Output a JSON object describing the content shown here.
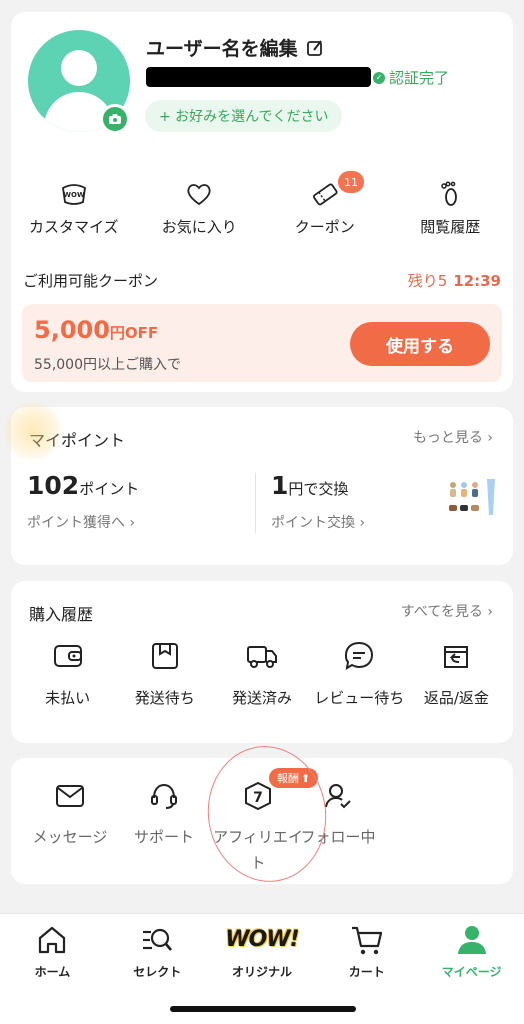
{
  "profile": {
    "username": "ユーザー名を編集",
    "verified_label": "認証完了",
    "preference_pill": "+ お好みを選んでください"
  },
  "quick_actions": [
    {
      "icon": "wow-icon",
      "label": "カスタマイズ"
    },
    {
      "icon": "heart-icon",
      "label": "お気に入り"
    },
    {
      "icon": "coupon-icon",
      "label": "クーポン",
      "badge": "11"
    },
    {
      "icon": "footprint-icon",
      "label": "閲覧履歴"
    }
  ],
  "coupon": {
    "heading": "ご利用可能クーポン",
    "remaining_label": "残り5",
    "timer": "12:39",
    "amount": "5,000",
    "amount_unit": "円OFF",
    "minimum": "55,000円以上ご購入で",
    "use_button": "使用する"
  },
  "points": {
    "title": "マイポイント",
    "more": "もっと見る",
    "balance_value": "102",
    "balance_unit": "ポイント",
    "earn_link": "ポイント獲得へ",
    "exchange_value": "1",
    "exchange_unit": "円で交換",
    "exchange_link": "ポイント交換"
  },
  "purchase": {
    "title": "購入履歴",
    "more": "すべてを見る",
    "items": [
      {
        "icon": "wallet-icon",
        "label": "未払い"
      },
      {
        "icon": "box-icon",
        "label": "発送待ち"
      },
      {
        "icon": "truck-icon",
        "label": "発送済み"
      },
      {
        "icon": "review-icon",
        "label": "レビュー待ち"
      },
      {
        "icon": "return-icon",
        "label": "返品/返金"
      }
    ]
  },
  "misc": [
    {
      "icon": "mail-icon",
      "label": "メッセージ"
    },
    {
      "icon": "headset-icon",
      "label": "サポート"
    },
    {
      "icon": "affiliate-icon",
      "label": "アフィリエイト",
      "badge": "報酬"
    },
    {
      "icon": "follow-icon",
      "label": "フォロー中"
    }
  ],
  "nav": [
    {
      "icon": "home-icon",
      "label": "ホーム"
    },
    {
      "icon": "select-icon",
      "label": "セレクト"
    },
    {
      "icon": "wow-original-logo",
      "label": "オリジナル"
    },
    {
      "icon": "cart-icon",
      "label": "カート"
    },
    {
      "icon": "mypage-icon",
      "label": "マイページ",
      "active": true
    }
  ],
  "colors": {
    "accent_green": "#37b26a",
    "coupon_orange": "#f26b47",
    "avatar_teal": "#5ed3b4"
  }
}
